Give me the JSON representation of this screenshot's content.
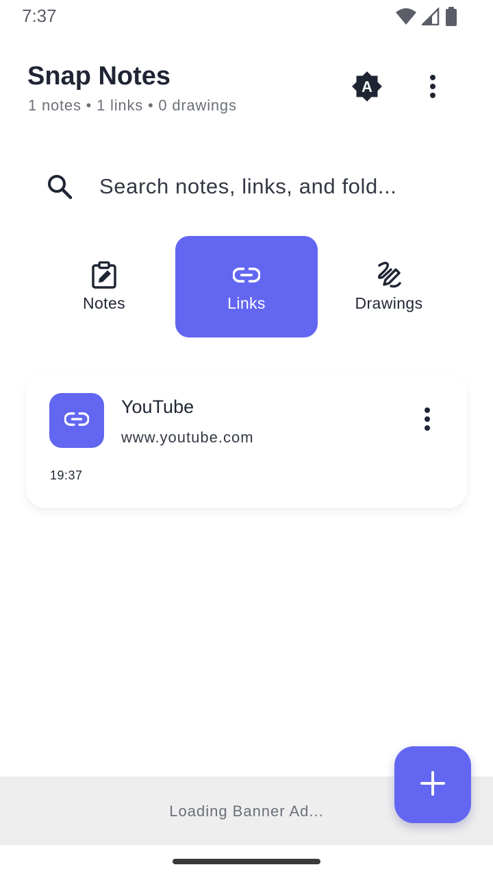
{
  "status_bar": {
    "time": "7:37",
    "icons": [
      "wifi-icon",
      "cell-signal-icon",
      "battery-icon"
    ]
  },
  "header": {
    "title": "Snap Notes",
    "stats": "1 notes • 1 links • 0 drawings",
    "actions": [
      "brightness-auto-icon",
      "more-vertical-icon"
    ]
  },
  "search": {
    "placeholder": "Search notes, links, and fold...",
    "value": ""
  },
  "tabs": [
    {
      "label": "Notes",
      "icon": "note-edit-icon",
      "active": false
    },
    {
      "label": "Links",
      "icon": "link-icon",
      "active": true
    },
    {
      "label": "Drawings",
      "icon": "drawing-icon",
      "active": false
    }
  ],
  "links": [
    {
      "title": "YouTube",
      "url": "www.youtube.com",
      "time": "19:37",
      "icon": "link-icon"
    }
  ],
  "ad_banner": {
    "text": "Loading Banner Ad..."
  },
  "fab": {
    "icon": "plus-icon"
  },
  "colors": {
    "accent": "#6366f1",
    "text": "#1f2533",
    "muted": "#6b6f78",
    "banner_bg": "#eeeeee"
  }
}
